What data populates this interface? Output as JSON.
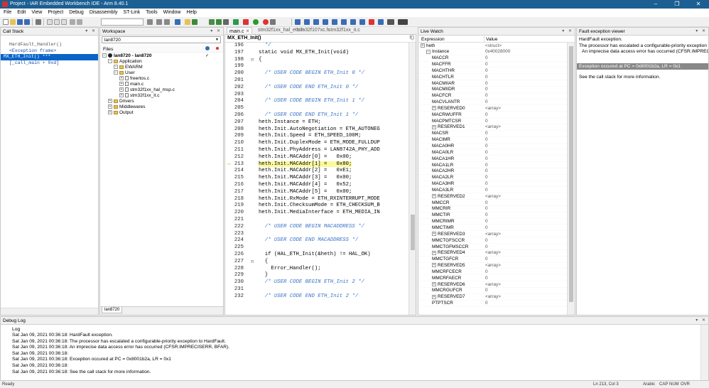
{
  "title": "Project - IAR Embedded Workbench IDE - Arm 8.40.1",
  "menu": [
    "File",
    "Edit",
    "View",
    "Project",
    "Debug",
    "Disassembly",
    "ST-Link",
    "Tools",
    "Window",
    "Help"
  ],
  "window_buttons": {
    "minimize": "–",
    "maximize": "❐",
    "close": "✕"
  },
  "callstack": {
    "title": "Call Stack",
    "lines": [
      "HardFault_Handler()",
      "<Exception frame>",
      "MX_ETH_Init() ***",
      "[_call_main + 0xd]"
    ]
  },
  "workspace": {
    "title": "Workspace",
    "config": "lan8720",
    "files_header": "Files",
    "tab": "lan8720",
    "tree": [
      {
        "label": "lan8720 - lan8720",
        "depth": 0,
        "kind": "root"
      },
      {
        "label": "Application",
        "depth": 1,
        "kind": "folder"
      },
      {
        "label": "EWARM",
        "depth": 2,
        "kind": "folder"
      },
      {
        "label": "User",
        "depth": 2,
        "kind": "folder"
      },
      {
        "label": "freertos.c",
        "depth": 3,
        "kind": "file"
      },
      {
        "label": "main.c",
        "depth": 3,
        "kind": "file"
      },
      {
        "label": "stm32f1xx_hal_msp.c",
        "depth": 3,
        "kind": "file"
      },
      {
        "label": "stm32f1xx_it.c",
        "depth": 3,
        "kind": "file"
      },
      {
        "label": "Drivers",
        "depth": 1,
        "kind": "folder"
      },
      {
        "label": "Middlewares",
        "depth": 1,
        "kind": "folder"
      },
      {
        "label": "Output",
        "depth": 1,
        "kind": "folder"
      }
    ]
  },
  "editor": {
    "tabs": [
      "main.c",
      "stm32f1xx_hal_eth.h",
      "stm32f107xc.h",
      "stm32f1xx_it.c"
    ],
    "function": "MX_ETH_Init()",
    "fn_button": "f()",
    "lines": [
      {
        "n": "196",
        "t": "  */",
        "c": "cmt"
      },
      {
        "n": "197",
        "t": "static void MX_ETH_Init(void)",
        "c": "kw"
      },
      {
        "n": "198",
        "t": "{",
        "c": "kw"
      },
      {
        "n": "199",
        "t": "",
        "c": ""
      },
      {
        "n": "200",
        "t": "  /* USER CODE BEGIN ETH_Init 0 */",
        "c": "cmt"
      },
      {
        "n": "201",
        "t": "",
        "c": ""
      },
      {
        "n": "202",
        "t": "  /* USER CODE END ETH_Init 0 */",
        "c": "cmt"
      },
      {
        "n": "203",
        "t": "",
        "c": ""
      },
      {
        "n": "204",
        "t": "  /* USER CODE BEGIN ETH_Init 1 */",
        "c": "cmt"
      },
      {
        "n": "205",
        "t": "",
        "c": ""
      },
      {
        "n": "206",
        "t": "  /* USER CODE END ETH_Init 1 */",
        "c": "cmt"
      },
      {
        "n": "207",
        "t": "heth.Instance = ETH;",
        "c": "kw"
      },
      {
        "n": "208",
        "t": "heth.Init.AutoNegotiation = ETH_AUTONEG",
        "c": "kw"
      },
      {
        "n": "209",
        "t": "heth.Init.Speed = ETH_SPEED_100M;",
        "c": "kw"
      },
      {
        "n": "210",
        "t": "heth.Init.DuplexMode = ETH_MODE_FULLDUP",
        "c": "kw"
      },
      {
        "n": "211",
        "t": "heth.Init.PhyAddress = LAN8742A_PHY_ADD",
        "c": "kw"
      },
      {
        "n": "212",
        "t": "heth.Init.MACAddr[0] =   0x00;",
        "c": "kw"
      },
      {
        "n": "213",
        "t": "heth.Init.MACAddr[1] =   0x80;",
        "c": "kw"
      },
      {
        "n": "214",
        "t": "heth.Init.MACAddr[2] =   0xE1;",
        "c": "kw"
      },
      {
        "n": "215",
        "t": "heth.Init.MACAddr[3] =   0x00;",
        "c": "kw"
      },
      {
        "n": "216",
        "t": "heth.Init.MACAddr[4] =   0x52;",
        "c": "kw"
      },
      {
        "n": "217",
        "t": "heth.Init.MACAddr[5] =   0x00;",
        "c": "kw"
      },
      {
        "n": "218",
        "t": "heth.Init.RxMode = ETH_RXINTERRUPT_MODE",
        "c": "kw"
      },
      {
        "n": "219",
        "t": "heth.Init.ChecksumMode = ETH_CHECKSUM_B",
        "c": "kw"
      },
      {
        "n": "220",
        "t": "heth.Init.MediaInterface = ETH_MEDIA_IN",
        "c": "kw"
      },
      {
        "n": "221",
        "t": "",
        "c": ""
      },
      {
        "n": "222",
        "t": "  /* USER CODE BEGIN MACADDRESS */",
        "c": "cmt"
      },
      {
        "n": "223",
        "t": "",
        "c": ""
      },
      {
        "n": "224",
        "t": "  /* USER CODE END MACADDRESS */",
        "c": "cmt"
      },
      {
        "n": "225",
        "t": "",
        "c": ""
      },
      {
        "n": "226",
        "t": "  if (HAL_ETH_Init(&heth) != HAL_OK)",
        "c": "kw"
      },
      {
        "n": "227",
        "t": "  {",
        "c": "kw"
      },
      {
        "n": "228",
        "t": "    Error_Handler();",
        "c": "kw"
      },
      {
        "n": "229",
        "t": "  }",
        "c": "kw"
      },
      {
        "n": "230",
        "t": "  /* USER CODE BEGIN ETH_Init 2 */",
        "c": "cmt"
      },
      {
        "n": "231",
        "t": "",
        "c": ""
      },
      {
        "n": "232",
        "t": "  /* USER CODE END ETH_Init 2 */",
        "c": "cmt"
      }
    ],
    "current_line": "213"
  },
  "livewatch": {
    "title": "Live Watch",
    "col_expr": "Expression",
    "col_value": "Value",
    "rows": [
      {
        "e": "heth",
        "v": "<struct>",
        "d": 0,
        "x": "+"
      },
      {
        "e": "Instance",
        "v": "0x40028000",
        "d": 1,
        "x": "-"
      },
      {
        "e": "MACCR",
        "v": "0",
        "d": 2,
        "x": ""
      },
      {
        "e": "MACFFR",
        "v": "0",
        "d": 2,
        "x": ""
      },
      {
        "e": "MACHTHR",
        "v": "0",
        "d": 2,
        "x": ""
      },
      {
        "e": "MACHTLR",
        "v": "0",
        "d": 2,
        "x": ""
      },
      {
        "e": "MACMIIAR",
        "v": "0",
        "d": 2,
        "x": ""
      },
      {
        "e": "MACMIIDR",
        "v": "0",
        "d": 2,
        "x": ""
      },
      {
        "e": "MACFCR",
        "v": "0",
        "d": 2,
        "x": ""
      },
      {
        "e": "MACVLANTR",
        "v": "0",
        "d": 2,
        "x": ""
      },
      {
        "e": "RESERVED0",
        "v": "<array>",
        "d": 2,
        "x": "+"
      },
      {
        "e": "MACRWUFFR",
        "v": "0",
        "d": 2,
        "x": ""
      },
      {
        "e": "MACPMTCSR",
        "v": "0",
        "d": 2,
        "x": ""
      },
      {
        "e": "RESERVED1",
        "v": "<array>",
        "d": 2,
        "x": "+"
      },
      {
        "e": "MACSR",
        "v": "0",
        "d": 2,
        "x": ""
      },
      {
        "e": "MACIMR",
        "v": "0",
        "d": 2,
        "x": ""
      },
      {
        "e": "MACA0HR",
        "v": "0",
        "d": 2,
        "x": ""
      },
      {
        "e": "MACA0LR",
        "v": "0",
        "d": 2,
        "x": ""
      },
      {
        "e": "MACA1HR",
        "v": "0",
        "d": 2,
        "x": ""
      },
      {
        "e": "MACA1LR",
        "v": "0",
        "d": 2,
        "x": ""
      },
      {
        "e": "MACA2HR",
        "v": "0",
        "d": 2,
        "x": ""
      },
      {
        "e": "MACA2LR",
        "v": "0",
        "d": 2,
        "x": ""
      },
      {
        "e": "MACA3HR",
        "v": "0",
        "d": 2,
        "x": ""
      },
      {
        "e": "MACA3LR",
        "v": "0",
        "d": 2,
        "x": ""
      },
      {
        "e": "RESERVED2",
        "v": "<array>",
        "d": 2,
        "x": "+"
      },
      {
        "e": "MMCCR",
        "v": "0",
        "d": 2,
        "x": ""
      },
      {
        "e": "MMCRIR",
        "v": "0",
        "d": 2,
        "x": ""
      },
      {
        "e": "MMCTIR",
        "v": "0",
        "d": 2,
        "x": ""
      },
      {
        "e": "MMCRIMR",
        "v": "0",
        "d": 2,
        "x": ""
      },
      {
        "e": "MMCTIMR",
        "v": "0",
        "d": 2,
        "x": ""
      },
      {
        "e": "RESERVED3",
        "v": "<array>",
        "d": 2,
        "x": "+"
      },
      {
        "e": "MMCTGFSCCR",
        "v": "0",
        "d": 2,
        "x": ""
      },
      {
        "e": "MMCTGFMSCCR",
        "v": "0",
        "d": 2,
        "x": ""
      },
      {
        "e": "RESERVED4",
        "v": "<array>",
        "d": 2,
        "x": "+"
      },
      {
        "e": "MMCTGFCR",
        "v": "0",
        "d": 2,
        "x": ""
      },
      {
        "e": "RESERVED5",
        "v": "<array>",
        "d": 2,
        "x": "+"
      },
      {
        "e": "MMCRFCECR",
        "v": "0",
        "d": 2,
        "x": ""
      },
      {
        "e": "MMCRFAECR",
        "v": "0",
        "d": 2,
        "x": ""
      },
      {
        "e": "RESERVED6",
        "v": "<array>",
        "d": 2,
        "x": "+"
      },
      {
        "e": "MMCRGUFCR",
        "v": "0",
        "d": 2,
        "x": ""
      },
      {
        "e": "RESERVED7",
        "v": "<array>",
        "d": 2,
        "x": "+"
      },
      {
        "e": "PTPTSCR",
        "v": "0",
        "d": 2,
        "x": ""
      }
    ]
  },
  "fault": {
    "title": "Fault exception viewer",
    "l1": "HardFault exception.",
    "l2": "The processor has escalated a configurable-priority exception to HardFault.",
    "l3": "An imprecise data access error has occurred (CFSR.IMPRECISERR, BFAR).",
    "l4": "Exception occured at PC = 0x8001b2a, LR = 0x1",
    "l5": "See the call stack for more information."
  },
  "debuglog": {
    "title": "Debug Log",
    "header": "Log",
    "lines": [
      "Sat Jan 09, 2021 00:36:18: HardFault exception.",
      "Sat Jan 09, 2021 00:36:18: The processor has escalated a configurable-priority exception to HardFault.",
      "Sat Jan 09, 2021 00:36:18:   An imprecise data access error has occurred (CFSR.IMPRECISERR, BFAR).",
      "Sat Jan 09, 2021 00:36:18:",
      "Sat Jan 09, 2021 00:36:18: Exception occured at PC = 0x8001b2a, LR = 0x1",
      "Sat Jan 09, 2021 00:36:18:",
      "Sat Jan 09, 2021 00:36:18: See the call stack for more information."
    ]
  },
  "status": {
    "left": "Ready",
    "pos": "Ln 213, Col 3",
    "lang": "Arabic",
    "cap": "CAP",
    "num": "NUM",
    "ovr": "OVR"
  },
  "colors": {
    "titlebar": "#1b5f93",
    "selection": "#0a64c8",
    "highlight": "#fafa9a",
    "comment": "#3a73c8"
  }
}
